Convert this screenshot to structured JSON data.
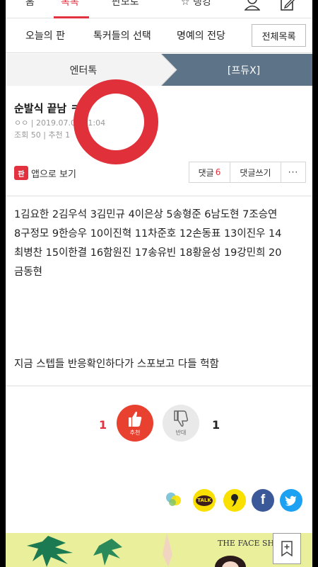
{
  "top_nav": {
    "items": [
      "홈",
      "톡톡",
      "판모로",
      "랭킹"
    ]
  },
  "sub_nav": {
    "items": [
      "오늘의 판",
      "톡커들의 선택",
      "명예의 전당"
    ],
    "all_button": "전체목록"
  },
  "category_tabs": {
    "left": "엔터톡",
    "right": "[프듀X]"
  },
  "article": {
    "title": "순발식 끝남 ㅋㅋ",
    "author": "ㅇㅇ",
    "datetime": "2019.07.06 21:04",
    "views": "조회 50",
    "recommend": "추천 1"
  },
  "actions": {
    "app_icon_text": "판",
    "app_view": "앱으로 보기",
    "comment_label": "댓글",
    "comment_count": "6",
    "write_comment": "댓글쓰기",
    "more": "···"
  },
  "content": {
    "lines": [
      "1김요한 2김우석 3김민규 4이은상 5송형준 6남도현 7조승연",
      "8구정모 9한승우 10이진혁 11차준호 12손동표 13이진우 14",
      "최병찬 15이한결 16함원진 17송유빈 18황윤성 19강민희 20",
      "금동현"
    ],
    "closing": "지금 스텝들 반응확인하다가 스포보고 다들 헉함"
  },
  "votes": {
    "up_count": "1",
    "up_label": "추천",
    "down_count": "1",
    "down_label": "반대"
  },
  "share": {
    "kakaotalk_label": "TALK",
    "icons": [
      "kakaostory-icon",
      "kakaotalk-icon",
      "comma-icon",
      "facebook-icon",
      "twitter-icon"
    ]
  },
  "ad": {
    "brand": "THE FACE SHOP"
  },
  "colors": {
    "accent": "#e2313f",
    "tab_dark": "#5c7388",
    "ring": "#e0303a",
    "facebook": "#3b5998",
    "twitter": "#1da1f2",
    "kakao": "#f9e000"
  }
}
